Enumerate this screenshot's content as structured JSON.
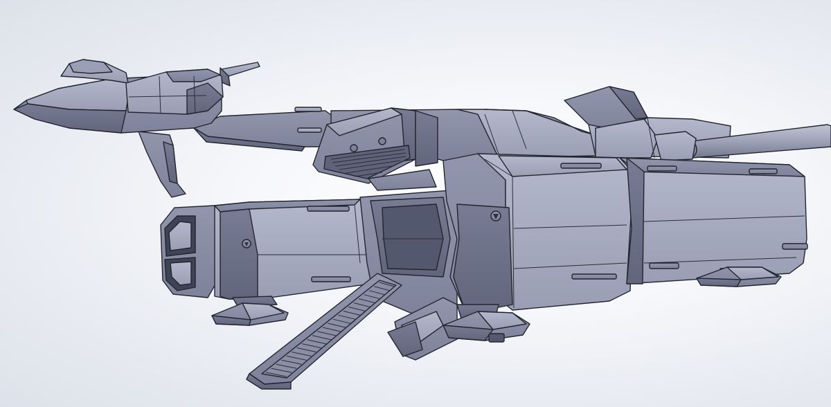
{
  "scene": {
    "subject": "cad-render-spacecraft",
    "background_color": "#eef0f5",
    "model_colors": {
      "light": "#a9adc1",
      "mid": "#8a8ea6",
      "dark": "#6d7189",
      "darkest": "#55596f",
      "edge": "#22252e"
    }
  }
}
